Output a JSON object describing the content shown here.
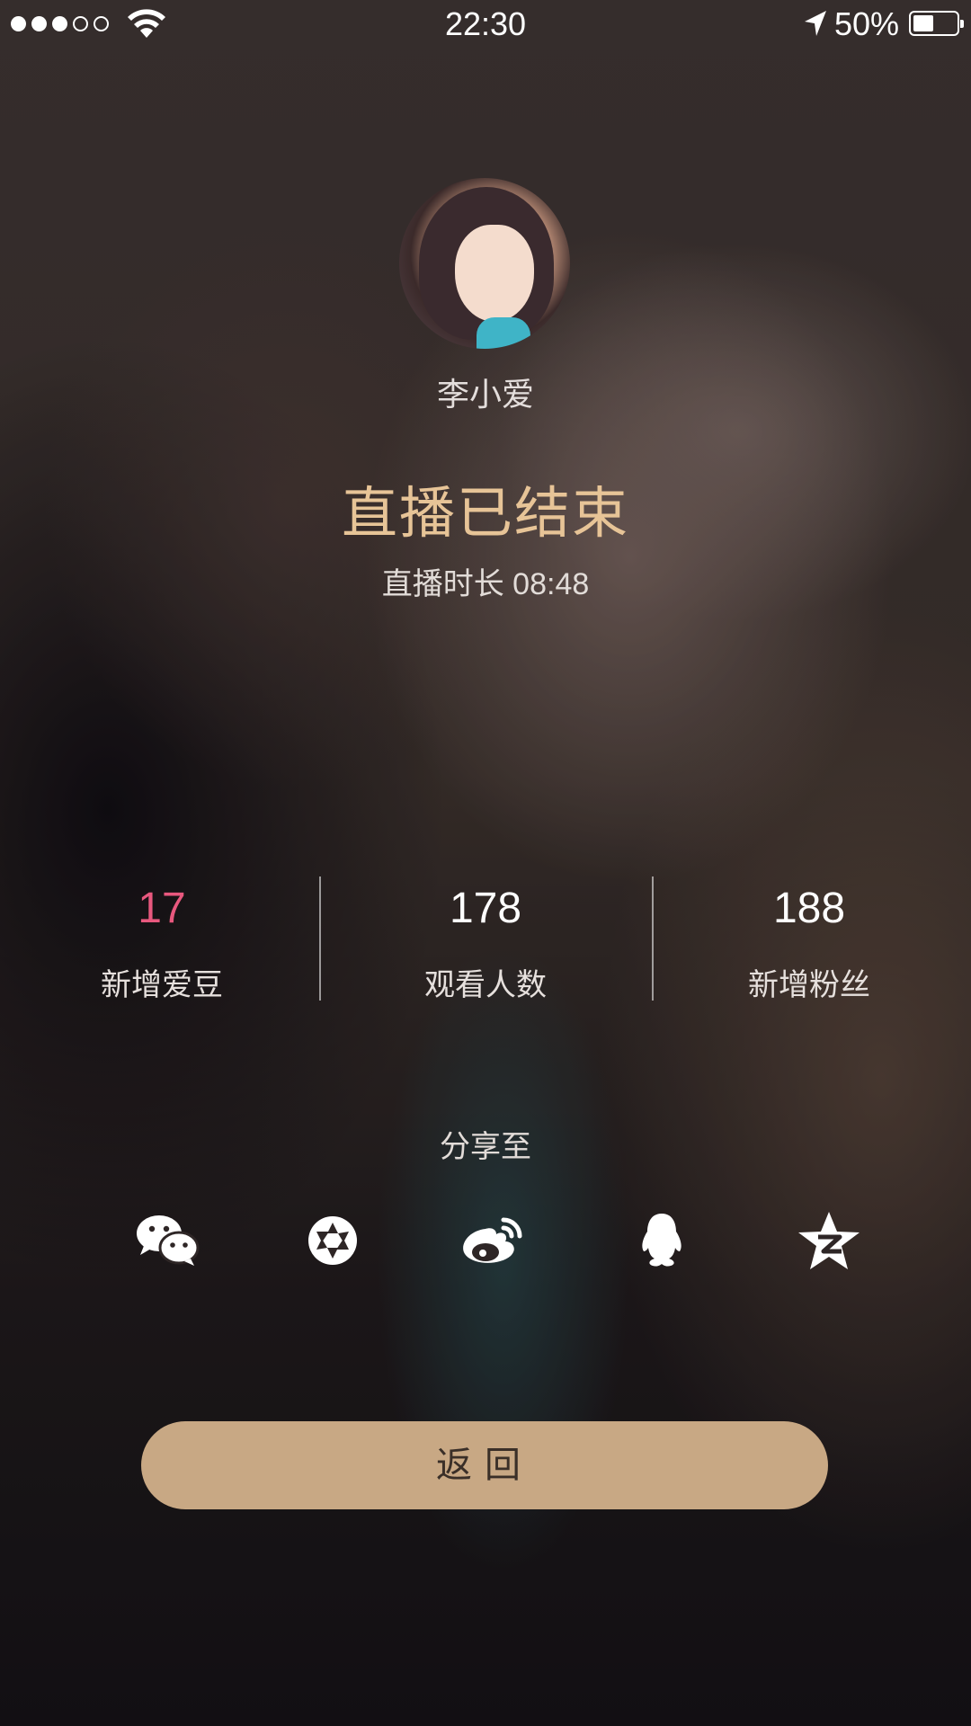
{
  "status_bar": {
    "time": "22:30",
    "battery_percent_text": "50%",
    "battery_level": 0.5,
    "signal_bars_filled": 3,
    "signal_bars_total": 5
  },
  "profile": {
    "name": "李小爱"
  },
  "live": {
    "ended_title": "直播已结束",
    "duration_text": "直播时长 08:48"
  },
  "stats": [
    {
      "value": "17",
      "label": "新增爱豆",
      "value_color": "#e8587e"
    },
    {
      "value": "178",
      "label": "观看人数",
      "value_color": "#ffffff"
    },
    {
      "value": "188",
      "label": "新增粉丝",
      "value_color": "#ffffff"
    }
  ],
  "share": {
    "title": "分享至",
    "targets": [
      {
        "icon": "wechat-icon"
      },
      {
        "icon": "moments-icon"
      },
      {
        "icon": "weibo-icon"
      },
      {
        "icon": "qq-icon"
      },
      {
        "icon": "qzone-icon"
      }
    ]
  },
  "back_button": {
    "label": "返回"
  },
  "colors": {
    "accent_gold": "#e7c497",
    "button_bg": "#c8a884",
    "highlight_pink": "#e8587e"
  }
}
